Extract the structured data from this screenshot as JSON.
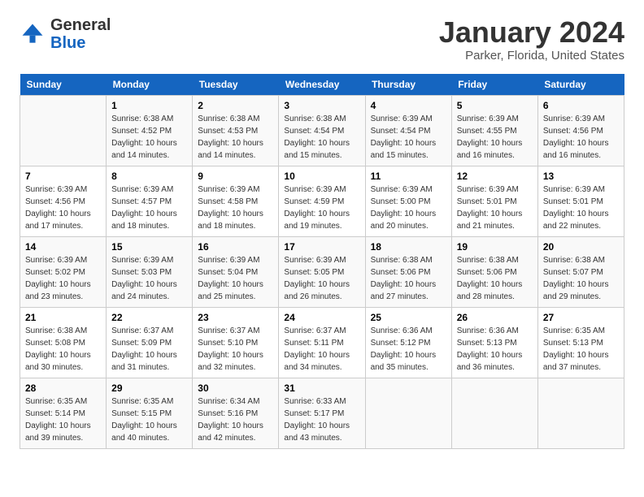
{
  "header": {
    "logo_general": "General",
    "logo_blue": "Blue",
    "title": "January 2024",
    "subtitle": "Parker, Florida, United States"
  },
  "days_of_week": [
    "Sunday",
    "Monday",
    "Tuesday",
    "Wednesday",
    "Thursday",
    "Friday",
    "Saturday"
  ],
  "weeks": [
    [
      {
        "num": "",
        "info": ""
      },
      {
        "num": "1",
        "info": "Sunrise: 6:38 AM\nSunset: 4:52 PM\nDaylight: 10 hours\nand 14 minutes."
      },
      {
        "num": "2",
        "info": "Sunrise: 6:38 AM\nSunset: 4:53 PM\nDaylight: 10 hours\nand 14 minutes."
      },
      {
        "num": "3",
        "info": "Sunrise: 6:38 AM\nSunset: 4:54 PM\nDaylight: 10 hours\nand 15 minutes."
      },
      {
        "num": "4",
        "info": "Sunrise: 6:39 AM\nSunset: 4:54 PM\nDaylight: 10 hours\nand 15 minutes."
      },
      {
        "num": "5",
        "info": "Sunrise: 6:39 AM\nSunset: 4:55 PM\nDaylight: 10 hours\nand 16 minutes."
      },
      {
        "num": "6",
        "info": "Sunrise: 6:39 AM\nSunset: 4:56 PM\nDaylight: 10 hours\nand 16 minutes."
      }
    ],
    [
      {
        "num": "7",
        "info": "Sunrise: 6:39 AM\nSunset: 4:56 PM\nDaylight: 10 hours\nand 17 minutes."
      },
      {
        "num": "8",
        "info": "Sunrise: 6:39 AM\nSunset: 4:57 PM\nDaylight: 10 hours\nand 18 minutes."
      },
      {
        "num": "9",
        "info": "Sunrise: 6:39 AM\nSunset: 4:58 PM\nDaylight: 10 hours\nand 18 minutes."
      },
      {
        "num": "10",
        "info": "Sunrise: 6:39 AM\nSunset: 4:59 PM\nDaylight: 10 hours\nand 19 minutes."
      },
      {
        "num": "11",
        "info": "Sunrise: 6:39 AM\nSunset: 5:00 PM\nDaylight: 10 hours\nand 20 minutes."
      },
      {
        "num": "12",
        "info": "Sunrise: 6:39 AM\nSunset: 5:01 PM\nDaylight: 10 hours\nand 21 minutes."
      },
      {
        "num": "13",
        "info": "Sunrise: 6:39 AM\nSunset: 5:01 PM\nDaylight: 10 hours\nand 22 minutes."
      }
    ],
    [
      {
        "num": "14",
        "info": "Sunrise: 6:39 AM\nSunset: 5:02 PM\nDaylight: 10 hours\nand 23 minutes."
      },
      {
        "num": "15",
        "info": "Sunrise: 6:39 AM\nSunset: 5:03 PM\nDaylight: 10 hours\nand 24 minutes."
      },
      {
        "num": "16",
        "info": "Sunrise: 6:39 AM\nSunset: 5:04 PM\nDaylight: 10 hours\nand 25 minutes."
      },
      {
        "num": "17",
        "info": "Sunrise: 6:39 AM\nSunset: 5:05 PM\nDaylight: 10 hours\nand 26 minutes."
      },
      {
        "num": "18",
        "info": "Sunrise: 6:38 AM\nSunset: 5:06 PM\nDaylight: 10 hours\nand 27 minutes."
      },
      {
        "num": "19",
        "info": "Sunrise: 6:38 AM\nSunset: 5:06 PM\nDaylight: 10 hours\nand 28 minutes."
      },
      {
        "num": "20",
        "info": "Sunrise: 6:38 AM\nSunset: 5:07 PM\nDaylight: 10 hours\nand 29 minutes."
      }
    ],
    [
      {
        "num": "21",
        "info": "Sunrise: 6:38 AM\nSunset: 5:08 PM\nDaylight: 10 hours\nand 30 minutes."
      },
      {
        "num": "22",
        "info": "Sunrise: 6:37 AM\nSunset: 5:09 PM\nDaylight: 10 hours\nand 31 minutes."
      },
      {
        "num": "23",
        "info": "Sunrise: 6:37 AM\nSunset: 5:10 PM\nDaylight: 10 hours\nand 32 minutes."
      },
      {
        "num": "24",
        "info": "Sunrise: 6:37 AM\nSunset: 5:11 PM\nDaylight: 10 hours\nand 34 minutes."
      },
      {
        "num": "25",
        "info": "Sunrise: 6:36 AM\nSunset: 5:12 PM\nDaylight: 10 hours\nand 35 minutes."
      },
      {
        "num": "26",
        "info": "Sunrise: 6:36 AM\nSunset: 5:13 PM\nDaylight: 10 hours\nand 36 minutes."
      },
      {
        "num": "27",
        "info": "Sunrise: 6:35 AM\nSunset: 5:13 PM\nDaylight: 10 hours\nand 37 minutes."
      }
    ],
    [
      {
        "num": "28",
        "info": "Sunrise: 6:35 AM\nSunset: 5:14 PM\nDaylight: 10 hours\nand 39 minutes."
      },
      {
        "num": "29",
        "info": "Sunrise: 6:35 AM\nSunset: 5:15 PM\nDaylight: 10 hours\nand 40 minutes."
      },
      {
        "num": "30",
        "info": "Sunrise: 6:34 AM\nSunset: 5:16 PM\nDaylight: 10 hours\nand 42 minutes."
      },
      {
        "num": "31",
        "info": "Sunrise: 6:33 AM\nSunset: 5:17 PM\nDaylight: 10 hours\nand 43 minutes."
      },
      {
        "num": "",
        "info": ""
      },
      {
        "num": "",
        "info": ""
      },
      {
        "num": "",
        "info": ""
      }
    ]
  ]
}
